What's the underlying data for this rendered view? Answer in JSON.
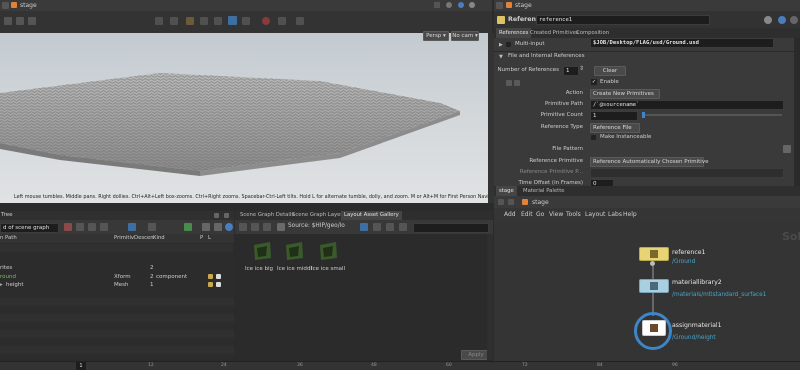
{
  "viewer": {
    "title": "stage",
    "persp": "Persp",
    "cam": "No cam",
    "status": "Left mouse tumbles. Middle pans. Right dollies. Ctrl+Alt+Left box-zooms. Ctrl+Right zooms. Spacebar-Ctrl-Left tilts. Hold L for alternate tumble, dolly, and zoom.    M or Alt+M for First Person Navigation."
  },
  "parameters": {
    "title": "stage",
    "node_type": "Reference",
    "node_name": "reference1",
    "tabs": [
      "References",
      "Created Primitives",
      "Composition"
    ],
    "multi_input_label": "Multi-input",
    "section_label": "File and Internal References",
    "num_refs_label": "Number of References",
    "num_refs_value": "1",
    "clear_label": "Clear",
    "enable_label": "Enable",
    "action_label": "Action",
    "action_value": "Create New Primitives",
    "prim_path_label": "Primitive Path",
    "prim_path_value": "/`@sourcename`",
    "prim_count_label": "Primitive Count",
    "prim_count_value": "1",
    "ref_type_label": "Reference Type",
    "ref_type_value": "Reference File",
    "instanceable_label": "Make Instanceable",
    "file_pattern_label": "File Pattern",
    "file_pattern_value": "$JOB/Desktop/FLAG/usd/Ground.usd",
    "ref_prim_label": "Reference Primitive",
    "ref_prim_value": "Reference Automatically Chosen Primitive",
    "ref_prim_path_label": "Reference Primitive P...",
    "time_offset_label": "Time Offset (in Frames)",
    "time_offset_value": "0"
  },
  "tree": {
    "title": "Tree",
    "filter": "d of scene graph",
    "columns": [
      "n Path",
      "Primitiv",
      "Descen",
      "Kind",
      "P",
      "L"
    ],
    "rows": [
      {
        "name": "rites",
        "type": "",
        "desc": "2",
        "kind": ""
      },
      {
        "name": "round",
        "type": "Xform",
        "desc": "2",
        "kind": "component"
      },
      {
        "name": "height",
        "type": "Mesh",
        "desc": "1",
        "kind": ""
      }
    ]
  },
  "gallery": {
    "tabs": [
      "Scene Graph Details",
      "Scene Graph Layers",
      "Layout Asset Gallery"
    ],
    "source": "Source: $HIP/geo/lo",
    "items": [
      "Ice ice big",
      "Ice ice middl",
      "Ice ice small"
    ],
    "apply": "Apply"
  },
  "network": {
    "tabs": [
      "stage",
      "Material Palette"
    ],
    "title": "stage",
    "menu": [
      "Add",
      "Edit",
      "Go",
      "View",
      "Tools",
      "Layout",
      "Labs",
      "Help"
    ],
    "watermark": "Solar",
    "nodes": [
      {
        "name": "reference1",
        "path": "/Ground"
      },
      {
        "name": "materiallibrary2",
        "path": "/materials/mtlstandard_surface1"
      },
      {
        "name": "assignmaterial1",
        "path": "/Ground/height"
      }
    ]
  },
  "timeline": {
    "frame": "1",
    "ticks": [
      "12",
      "24",
      "36",
      "48",
      "60",
      "72",
      "84",
      "96"
    ]
  },
  "colors": {
    "node_ref": "#e8d477",
    "node_mat": "#a9cfe0",
    "node_assign": "#ffffff",
    "selection_ring": "#3d86c7",
    "path_text": "#4aa3c8"
  }
}
